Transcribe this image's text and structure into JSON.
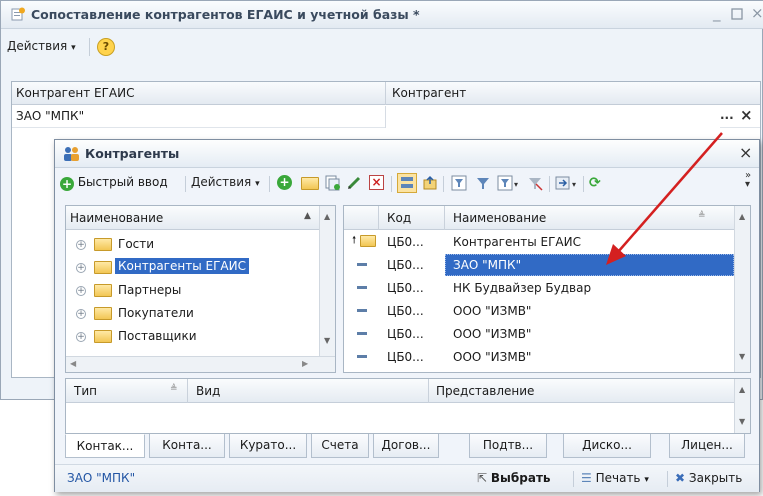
{
  "outer_window": {
    "title": "Сопоставление контрагентов ЕГАИС и учетной базы *",
    "toolbar": {
      "actions": "Действия",
      "help": "?"
    },
    "grid": {
      "columns": [
        "Контрагент ЕГАИС",
        "Контрагент"
      ],
      "rows": [
        {
          "egais": "ЗАО \"МПК\"",
          "counterparty": ""
        }
      ],
      "select_button": "...",
      "clear_button": "×"
    }
  },
  "inner_window": {
    "title": "Контрагенты",
    "close": "×",
    "toolbar": {
      "quick_input": "Быстрый ввод",
      "actions": "Действия"
    },
    "tree": {
      "header": "Наименование",
      "items": [
        "Гости",
        "Контрагенты ЕГАИС",
        "Партнеры",
        "Покупатели",
        "Поставщики"
      ],
      "selected_index": 1
    },
    "list": {
      "columns": {
        "code": "Код",
        "name": "Наименование"
      },
      "rows": [
        {
          "code": "ЦБ0...",
          "name": "Контрагенты ЕГАИС",
          "type": "folder-up"
        },
        {
          "code": "ЦБ0...",
          "name": "ЗАО \"МПК\"",
          "type": "item",
          "selected": true
        },
        {
          "code": "ЦБ0...",
          "name": "НК Будвайзер Будвар",
          "type": "item"
        },
        {
          "code": "ЦБ0...",
          "name": "ООО \"ИЗМВ\"",
          "type": "item"
        },
        {
          "code": "ЦБ0...",
          "name": "ООО \"ИЗМВ\"",
          "type": "item"
        },
        {
          "code": "ЦБ0...",
          "name": "ООО \"ИЗМВ\"",
          "type": "item"
        }
      ]
    },
    "contacts": {
      "columns": [
        "Тип",
        "Вид",
        "Представление"
      ]
    },
    "tabs": [
      "Контак...",
      "Конта...",
      "Курато...",
      "Счета",
      "Догов...",
      "Подтв...",
      "Диско...",
      "Лицен..."
    ],
    "status": {
      "current": "ЗАО \"МПК\"",
      "select": "Выбрать",
      "print": "Печать",
      "close": "Закрыть"
    }
  },
  "colors": {
    "selection": "#316ac5",
    "arrow": "#d42020",
    "title_text": "#3a4a5e",
    "link_text": "#2255a4"
  }
}
